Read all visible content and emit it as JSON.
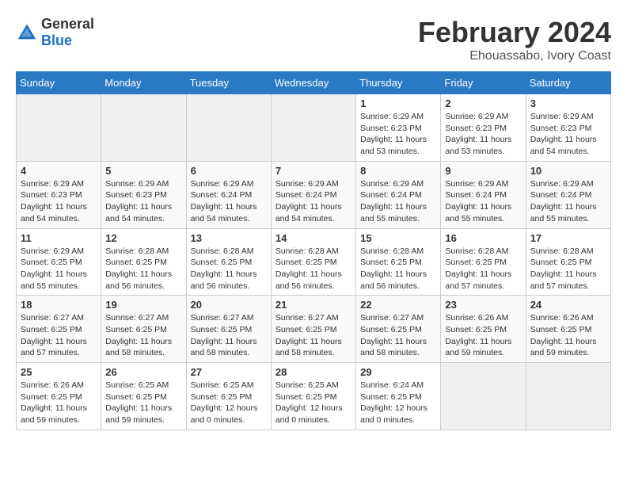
{
  "header": {
    "logo_general": "General",
    "logo_blue": "Blue",
    "month_year": "February 2024",
    "location": "Ehouassabo, Ivory Coast"
  },
  "days_of_week": [
    "Sunday",
    "Monday",
    "Tuesday",
    "Wednesday",
    "Thursday",
    "Friday",
    "Saturday"
  ],
  "weeks": [
    [
      {
        "day": "",
        "info": ""
      },
      {
        "day": "",
        "info": ""
      },
      {
        "day": "",
        "info": ""
      },
      {
        "day": "",
        "info": ""
      },
      {
        "day": "1",
        "info": "Sunrise: 6:29 AM\nSunset: 6:23 PM\nDaylight: 11 hours\nand 53 minutes."
      },
      {
        "day": "2",
        "info": "Sunrise: 6:29 AM\nSunset: 6:23 PM\nDaylight: 11 hours\nand 53 minutes."
      },
      {
        "day": "3",
        "info": "Sunrise: 6:29 AM\nSunset: 6:23 PM\nDaylight: 11 hours\nand 54 minutes."
      }
    ],
    [
      {
        "day": "4",
        "info": "Sunrise: 6:29 AM\nSunset: 6:23 PM\nDaylight: 11 hours\nand 54 minutes."
      },
      {
        "day": "5",
        "info": "Sunrise: 6:29 AM\nSunset: 6:23 PM\nDaylight: 11 hours\nand 54 minutes."
      },
      {
        "day": "6",
        "info": "Sunrise: 6:29 AM\nSunset: 6:24 PM\nDaylight: 11 hours\nand 54 minutes."
      },
      {
        "day": "7",
        "info": "Sunrise: 6:29 AM\nSunset: 6:24 PM\nDaylight: 11 hours\nand 54 minutes."
      },
      {
        "day": "8",
        "info": "Sunrise: 6:29 AM\nSunset: 6:24 PM\nDaylight: 11 hours\nand 55 minutes."
      },
      {
        "day": "9",
        "info": "Sunrise: 6:29 AM\nSunset: 6:24 PM\nDaylight: 11 hours\nand 55 minutes."
      },
      {
        "day": "10",
        "info": "Sunrise: 6:29 AM\nSunset: 6:24 PM\nDaylight: 11 hours\nand 55 minutes."
      }
    ],
    [
      {
        "day": "11",
        "info": "Sunrise: 6:29 AM\nSunset: 6:25 PM\nDaylight: 11 hours\nand 55 minutes."
      },
      {
        "day": "12",
        "info": "Sunrise: 6:28 AM\nSunset: 6:25 PM\nDaylight: 11 hours\nand 56 minutes."
      },
      {
        "day": "13",
        "info": "Sunrise: 6:28 AM\nSunset: 6:25 PM\nDaylight: 11 hours\nand 56 minutes."
      },
      {
        "day": "14",
        "info": "Sunrise: 6:28 AM\nSunset: 6:25 PM\nDaylight: 11 hours\nand 56 minutes."
      },
      {
        "day": "15",
        "info": "Sunrise: 6:28 AM\nSunset: 6:25 PM\nDaylight: 11 hours\nand 56 minutes."
      },
      {
        "day": "16",
        "info": "Sunrise: 6:28 AM\nSunset: 6:25 PM\nDaylight: 11 hours\nand 57 minutes."
      },
      {
        "day": "17",
        "info": "Sunrise: 6:28 AM\nSunset: 6:25 PM\nDaylight: 11 hours\nand 57 minutes."
      }
    ],
    [
      {
        "day": "18",
        "info": "Sunrise: 6:27 AM\nSunset: 6:25 PM\nDaylight: 11 hours\nand 57 minutes."
      },
      {
        "day": "19",
        "info": "Sunrise: 6:27 AM\nSunset: 6:25 PM\nDaylight: 11 hours\nand 58 minutes."
      },
      {
        "day": "20",
        "info": "Sunrise: 6:27 AM\nSunset: 6:25 PM\nDaylight: 11 hours\nand 58 minutes."
      },
      {
        "day": "21",
        "info": "Sunrise: 6:27 AM\nSunset: 6:25 PM\nDaylight: 11 hours\nand 58 minutes."
      },
      {
        "day": "22",
        "info": "Sunrise: 6:27 AM\nSunset: 6:25 PM\nDaylight: 11 hours\nand 58 minutes."
      },
      {
        "day": "23",
        "info": "Sunrise: 6:26 AM\nSunset: 6:25 PM\nDaylight: 11 hours\nand 59 minutes."
      },
      {
        "day": "24",
        "info": "Sunrise: 6:26 AM\nSunset: 6:25 PM\nDaylight: 11 hours\nand 59 minutes."
      }
    ],
    [
      {
        "day": "25",
        "info": "Sunrise: 6:26 AM\nSunset: 6:25 PM\nDaylight: 11 hours\nand 59 minutes."
      },
      {
        "day": "26",
        "info": "Sunrise: 6:25 AM\nSunset: 6:25 PM\nDaylight: 11 hours\nand 59 minutes."
      },
      {
        "day": "27",
        "info": "Sunrise: 6:25 AM\nSunset: 6:25 PM\nDaylight: 12 hours\nand 0 minutes."
      },
      {
        "day": "28",
        "info": "Sunrise: 6:25 AM\nSunset: 6:25 PM\nDaylight: 12 hours\nand 0 minutes."
      },
      {
        "day": "29",
        "info": "Sunrise: 6:24 AM\nSunset: 6:25 PM\nDaylight: 12 hours\nand 0 minutes."
      },
      {
        "day": "",
        "info": ""
      },
      {
        "day": "",
        "info": ""
      }
    ]
  ]
}
